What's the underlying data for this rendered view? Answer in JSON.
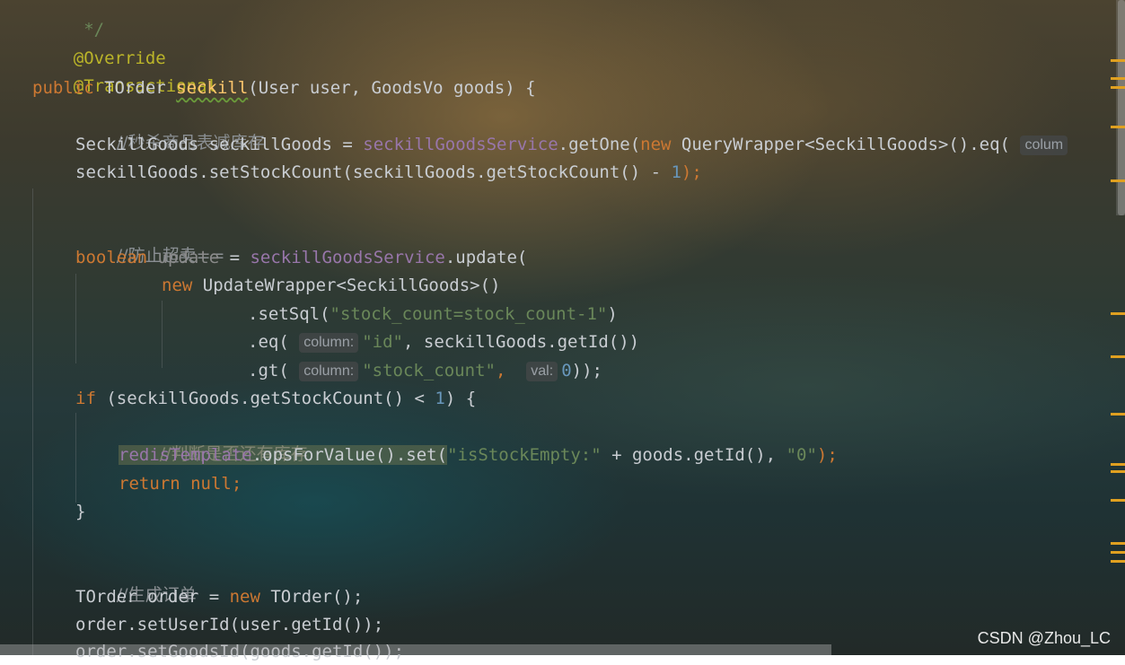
{
  "editor": {
    "lines": [
      {
        "id": "l0",
        "text": " */"
      },
      {
        "id": "l1",
        "text": "@Override"
      },
      {
        "id": "l2",
        "text": "@Transactional"
      },
      {
        "id": "l3",
        "kw": "public",
        "type": "TOrder",
        "method": "seckill",
        "sig": "(User user, GoodsVo goods) {"
      },
      {
        "id": "l4",
        "comment": "//秒杀商品表减库存"
      },
      {
        "id": "l5",
        "a": "SeckillGoods seckillGoods = ",
        "field": "seckillGoodsService",
        ".b": ".getOne(",
        "kw": "new",
        "c": " QueryWrapper<SeckillGoods>().eq(",
        "hint": "colum"
      },
      {
        "id": "l6",
        "a": "seckillGoods.setStockCount(seckillGoods.getStockCount() - ",
        "num": "1",
        "b": ");"
      },
      {
        "id": "l7",
        "comment": "//防止超卖=="
      },
      {
        "id": "l8",
        "kw": "boolean",
        "var": " update",
        "a": " = ",
        "field": "seckillGoodsService",
        "b": ".update("
      },
      {
        "id": "l9",
        "kw": "new",
        "a": " UpdateWrapper<SeckillGoods>()"
      },
      {
        "id": "l10",
        "a": ".setSql(",
        "str": "\"stock_count=stock_count-1\"",
        "b": ")"
      },
      {
        "id": "l11",
        "a": ".eq( ",
        "hint": "column:",
        "str": "\"id\"",
        "b": ", seckillGoods.getId())"
      },
      {
        "id": "l12",
        "a": ".gt( ",
        "hint": "column:",
        "str": "\"stock_count\"",
        "b": ",  ",
        "hint2": "val:",
        "num": "0",
        "c": "));"
      },
      {
        "id": "l13",
        "kw": "if",
        "a": " (seckillGoods.getStockCount() < ",
        "num": "1",
        "b": ") {"
      },
      {
        "id": "l14",
        "comment": "//判断是否还有库存"
      },
      {
        "id": "l15",
        "field": "redisTemplate",
        "a": ".opsForValue().set(",
        "str": "\"isStockEmpty:\"",
        "b": " + goods.getId(), ",
        "str2": "\"0\"",
        "c": ");"
      },
      {
        "id": "l16",
        "kw": "return null",
        "a": ";"
      },
      {
        "id": "l17",
        "a": "}"
      },
      {
        "id": "l18",
        "comment": "//生成订单"
      },
      {
        "id": "l19",
        "a": "TOrder order = ",
        "kw": "new",
        "b": " TOrder();"
      },
      {
        "id": "l20",
        "a": "order.setUserId(user.getId());"
      },
      {
        "id": "l21",
        "a": "order.setGoodsId(goods.getId());"
      }
    ]
  },
  "watermark": "CSDN @Zhou_LC",
  "colors": {
    "keyword": "#cc7832",
    "annotation": "#bbb529",
    "method": "#ffc66d",
    "field": "#9876aa",
    "string": "#6a8759",
    "number": "#6897bb",
    "comment": "#8a8f93",
    "warning_mark": "#e0a020"
  }
}
